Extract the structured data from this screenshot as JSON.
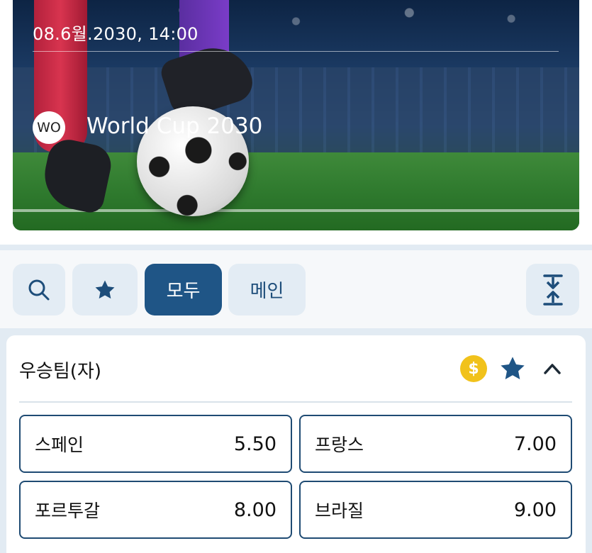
{
  "hero": {
    "datetime": "08.6월.2030, 14:00",
    "badge": "WO",
    "event_title": "World Cup 2030"
  },
  "filters": {
    "search_icon": "search-icon",
    "favorites_icon": "star-icon",
    "all_label": "모두",
    "main_label": "메인",
    "collapse_icon": "collapse-all-icon",
    "active": "all"
  },
  "market": {
    "title": "우승팀(자)",
    "coin_symbol": "$",
    "icons": [
      "dollar-coin-icon",
      "star-icon",
      "chevron-up-icon"
    ],
    "colors": {
      "accent": "#1f5586",
      "coin": "#f1c21b",
      "border": "#1f4b73"
    },
    "outcomes": [
      {
        "name": "스페인",
        "odds": "5.50"
      },
      {
        "name": "프랑스",
        "odds": "7.00"
      },
      {
        "name": "포르투갈",
        "odds": "8.00"
      },
      {
        "name": "브라질",
        "odds": "9.00"
      }
    ]
  }
}
